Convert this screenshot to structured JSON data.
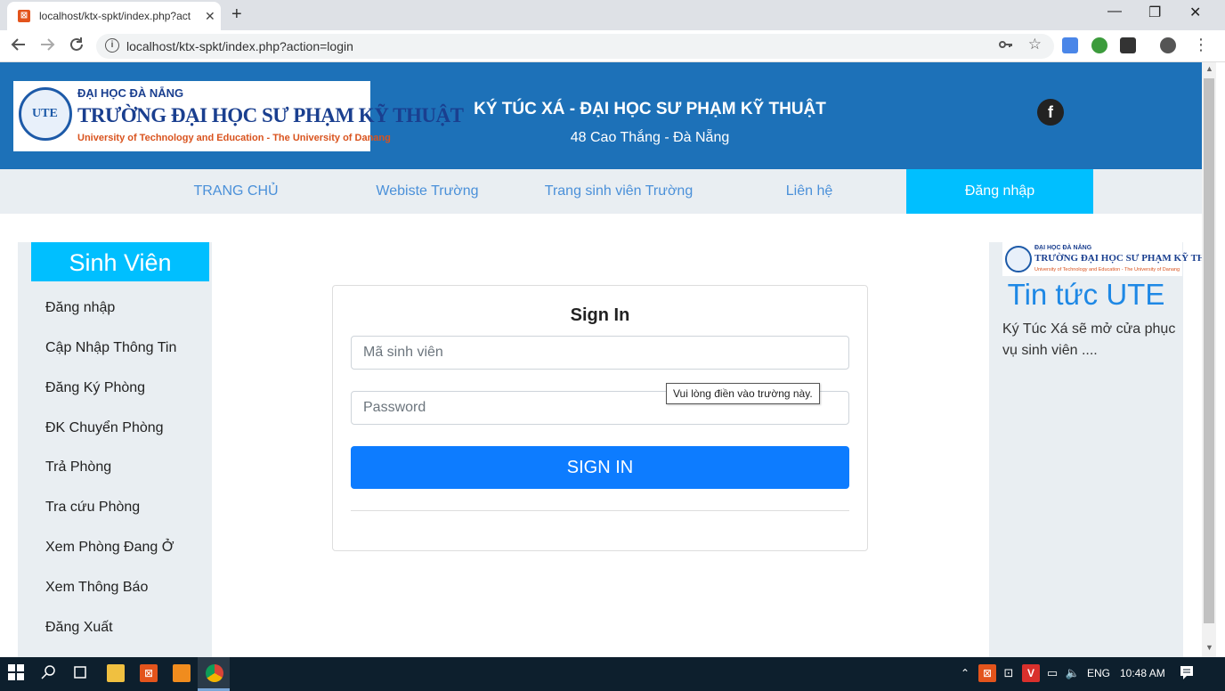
{
  "browser": {
    "tab_title": "localhost/ktx-spkt/index.php?act",
    "tab_close": "✕",
    "new_tab": "+",
    "url": "localhost/ktx-spkt/index.php?action=login",
    "window_minimize": "—",
    "window_restore": "❐",
    "window_close": "✕"
  },
  "header": {
    "logo_line1": "ĐẠI HỌC ĐÀ NẴNG",
    "logo_line2": "TRƯỜNG ĐẠI HỌC SƯ PHẠM KỸ THUẬT",
    "logo_line3": "University of Technology and Education - The University of Danang",
    "logo_seal": "UTE",
    "title": "KÝ TÚC XÁ - ĐẠI HỌC SƯ PHẠM KỸ THUẬT",
    "address": "48 Cao Thắng - Đà Nẵng",
    "facebook": "f"
  },
  "nav": {
    "items": [
      {
        "label": "TRANG CHỦ"
      },
      {
        "label": "Webiste Trường"
      },
      {
        "label": "Trang sinh viên Trường"
      },
      {
        "label": "Liên hệ"
      },
      {
        "label": "Đăng nhập"
      }
    ],
    "active_index": 4
  },
  "sidebar": {
    "title": "Sinh Viên",
    "items": [
      {
        "label": "Đăng nhập"
      },
      {
        "label": "Cập Nhập Thông Tin"
      },
      {
        "label": "Đăng Ký Phòng"
      },
      {
        "label": "ĐK Chuyển Phòng"
      },
      {
        "label": "Trả Phòng"
      },
      {
        "label": "Tra cứu Phòng"
      },
      {
        "label": "Xem Phòng Đang Ở"
      },
      {
        "label": "Xem Thông Báo"
      },
      {
        "label": "Đăng Xuất"
      }
    ]
  },
  "login": {
    "title": "Sign In",
    "student_id_placeholder": "Mã sinh viên",
    "password_placeholder": "Password",
    "button": "SIGN IN",
    "tooltip": "Vui lòng điền vào trường này."
  },
  "news": {
    "logo_line1": "ĐẠI HỌC ĐÀ NẴNG",
    "logo_line2": "TRƯỜNG ĐẠI HỌC SƯ PHẠM KỸ THUẬT",
    "logo_line3": "University of Technology and Education - The University of Danang",
    "title": "Tin tức UTE",
    "body": "Ký Túc Xá sẽ mở cửa phục vụ sinh viên ...."
  },
  "taskbar": {
    "language": "ENG",
    "time": "10:48 AM"
  },
  "colors": {
    "header_blue": "#1d71b8",
    "accent_cyan": "#00bfff",
    "button_blue": "#0d7cff",
    "panel_gray": "#e9eef2"
  }
}
